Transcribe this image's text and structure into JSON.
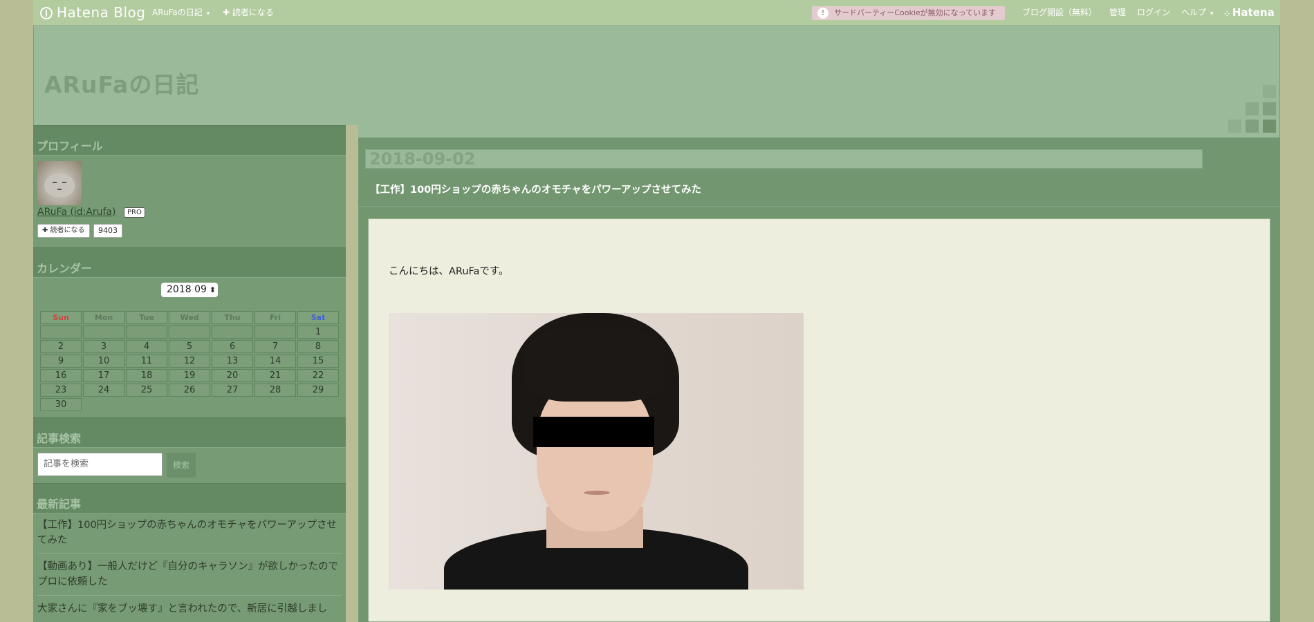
{
  "globalbar": {
    "logo_text": "Hatena Blog",
    "blog_menu": "ARuFaの日記",
    "subscribe": "✚ 読者になる",
    "cookie_warning": "サードパーティーCookieが無効になっています",
    "open_blog": "ブログ開設（無料）",
    "admin": "管理",
    "login": "ログイン",
    "help": "ヘルプ",
    "brand": "Hatena"
  },
  "header": {
    "blog_title": "ARuFaの日記"
  },
  "sidebar": {
    "profile": {
      "heading": "プロフィール",
      "name": "ARuFa (id:Arufa)",
      "badge": "PRO",
      "subscribe_label": "✚ 読者になる",
      "subscriber_count": "9403"
    },
    "calendar": {
      "heading": "カレンダー",
      "month": "2018 09",
      "days": [
        "Sun",
        "Mon",
        "Tue",
        "Wed",
        "Thu",
        "Fri",
        "Sat"
      ],
      "weeks": [
        [
          "",
          "",
          "",
          "",
          "",
          "",
          "1"
        ],
        [
          "2",
          "3",
          "4",
          "5",
          "6",
          "7",
          "8"
        ],
        [
          "9",
          "10",
          "11",
          "12",
          "13",
          "14",
          "15"
        ],
        [
          "16",
          "17",
          "18",
          "19",
          "20",
          "21",
          "22"
        ],
        [
          "23",
          "24",
          "25",
          "26",
          "27",
          "28",
          "29"
        ],
        [
          "30"
        ]
      ]
    },
    "search": {
      "heading": "記事検索",
      "placeholder": "記事を検索",
      "button": "検索"
    },
    "recent": {
      "heading": "最新記事",
      "items": [
        "【工作】100円ショップの赤ちゃんのオモチャをパワーアップさせてみた",
        "【動画あり】一般人だけど『自分のキャラソン』が欲しかったのでプロに依頼した",
        "大家さんに『家をブッ壊す』と言われたので、新居に引越しまし"
      ]
    }
  },
  "entry": {
    "date": "2018-09-02",
    "title": "【工作】100円ショップの赤ちゃんのオモチャをパワーアップさせてみた",
    "greeting": "こんにちは、ARuFaです。"
  },
  "colors": {
    "background": "#b9bd96",
    "header": "#9aba99",
    "sidebar": "#779b74",
    "entry_body": "#edeedd"
  }
}
